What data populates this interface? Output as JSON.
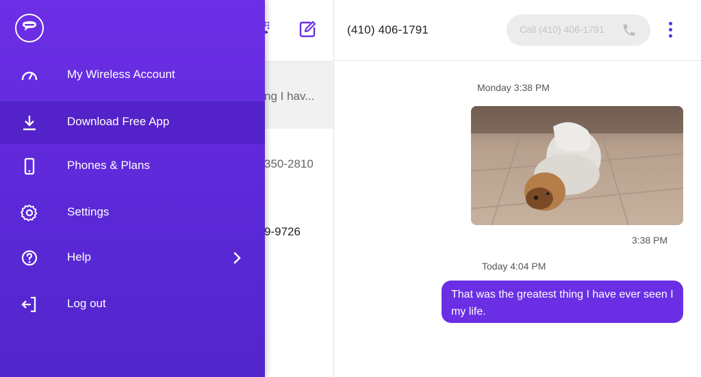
{
  "conversations": {
    "items": [
      {
        "snippet": "ng I hav..."
      },
      {
        "snippet": "350-2810"
      },
      {
        "snippet": "9-9726"
      }
    ]
  },
  "chat": {
    "title": "(410) 406-1791",
    "call_label": "Call (410) 406-1791",
    "messages": [
      {
        "timestamp": "Monday 3:38 PM"
      },
      {
        "time": "3:38 PM"
      },
      {
        "timestamp": "Today 4:04 PM"
      },
      {
        "text": "That was the greatest thing I have ever seen I my life."
      }
    ]
  },
  "drawer": {
    "items": [
      {
        "label": "My Wireless Account",
        "icon": "speedometer-icon"
      },
      {
        "label": "Download Free App",
        "icon": "download-icon"
      },
      {
        "label": "Phones & Plans",
        "icon": "phone-icon"
      },
      {
        "label": "Settings",
        "icon": "gear-icon"
      },
      {
        "label": "Help",
        "icon": "help-icon"
      },
      {
        "label": "Log out",
        "icon": "logout-icon"
      }
    ]
  },
  "colors": {
    "accent": "#6a2fe5",
    "drawer_top": "#6d2fe6",
    "drawer_bottom": "#5226cc",
    "highlight": "#5422c9"
  }
}
